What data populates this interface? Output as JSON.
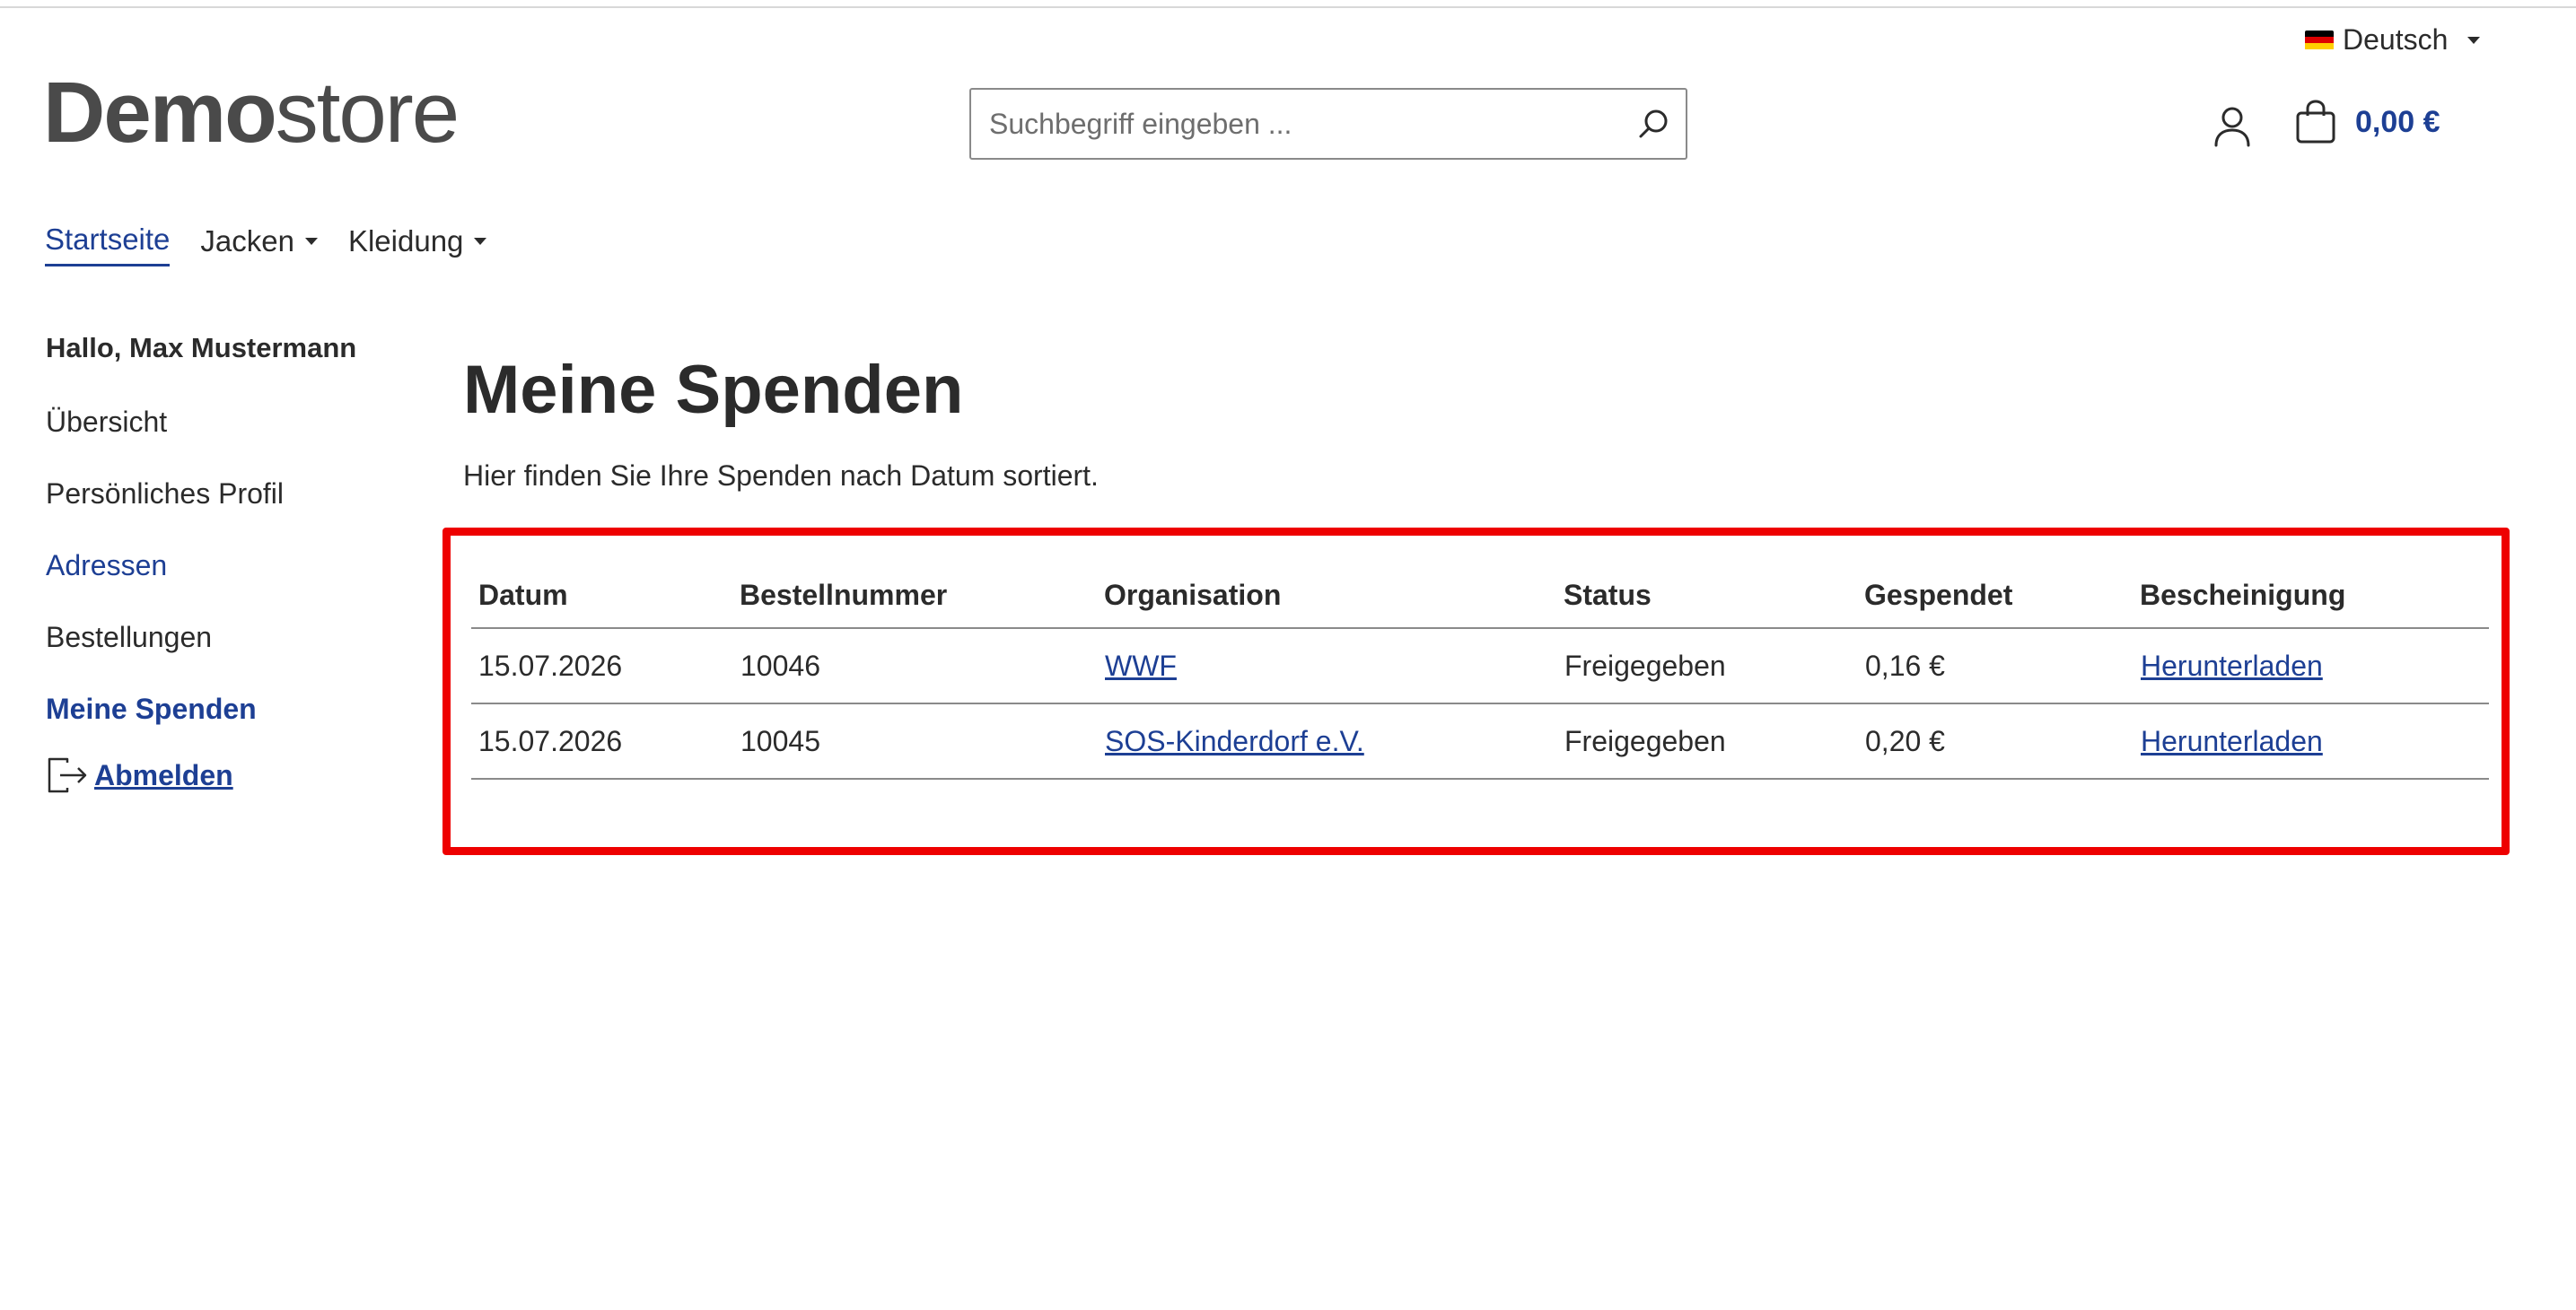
{
  "language": {
    "label": "Deutsch",
    "flag_colors": [
      "#000000",
      "#dd0000",
      "#ffce00"
    ]
  },
  "logo": {
    "bold": "Demo",
    "light": "store"
  },
  "search": {
    "placeholder": "Suchbegriff eingeben ..."
  },
  "cart": {
    "total": "0,00 €"
  },
  "nav": [
    {
      "label": "Startseite"
    },
    {
      "label": "Jacken"
    },
    {
      "label": "Kleidung"
    }
  ],
  "sidebar": {
    "greeting": "Hallo, Max Mustermann",
    "items": [
      {
        "label": "Übersicht"
      },
      {
        "label": "Persönliches Profil"
      },
      {
        "label": "Adressen"
      },
      {
        "label": "Bestellungen"
      },
      {
        "label": "Meine Spenden"
      }
    ],
    "logout": "Abmelden"
  },
  "page": {
    "title": "Meine Spenden",
    "description": "Hier finden Sie Ihre Spenden nach Datum sortiert."
  },
  "table": {
    "headers": [
      "Datum",
      "Bestellnummer",
      "Organisation",
      "Status",
      "Gespendet",
      "Bescheinigung"
    ],
    "rows": [
      [
        "15.07.2026",
        "10046",
        "WWF",
        "Freigegeben",
        "0,16 €",
        "Herunterladen"
      ],
      [
        "15.07.2026",
        "10045",
        "SOS-Kinderdorf e.V.",
        "Freigegeben",
        "0,20 €",
        "Herunterladen"
      ]
    ]
  },
  "colors": {
    "brand": "#1d3f94",
    "status_ok": "#4fc46a",
    "highlight": "#ee0000"
  }
}
